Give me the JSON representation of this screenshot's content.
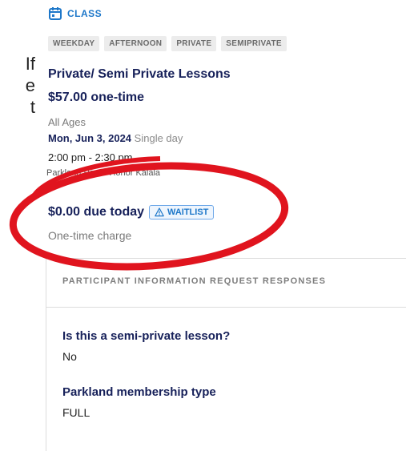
{
  "left_fragment": [
    "If",
    "e",
    "t"
  ],
  "class": {
    "type_label": "CLASS",
    "icon": "calendar-icon",
    "tags": [
      "WEEKDAY",
      "AFTERNOON",
      "PRIVATE",
      "SEMIPRIVATE"
    ],
    "title": "Private/ Semi Private Lessons",
    "price": "$57.00 one-time",
    "ages": "All Ages",
    "date": "Mon, Jun 3, 2024",
    "date_suffix": "Single day",
    "time": "2:00 pm - 2:30 pm",
    "location": "Parkland Pool • Honor Kalala"
  },
  "payment": {
    "due_text": "$0.00 due today",
    "badge_label": "WAITLIST",
    "badge_icon": "warning-triangle-icon",
    "charge_type": "One-time charge"
  },
  "responses": {
    "heading": "PARTICIPANT INFORMATION REQUEST RESPONSES",
    "items": [
      {
        "question": "Is this a semi-private lesson?",
        "answer": "No"
      },
      {
        "question": "Parkland membership type",
        "answer": "FULL"
      }
    ]
  },
  "colors": {
    "accent": "#1d77c9",
    "title": "#17215a",
    "annotation": "#e0141e"
  }
}
